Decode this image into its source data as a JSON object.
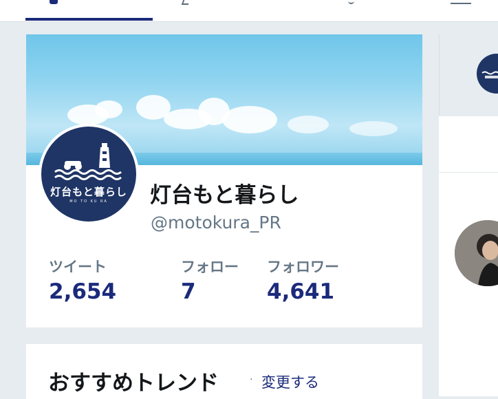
{
  "profile": {
    "display_name": "灯台もと暮らし",
    "handle": "@motokura_PR",
    "avatar_logo_text": "灯台もと暮らし",
    "avatar_logo_sub": "MO TO KU RA"
  },
  "stats": [
    {
      "label": "ツイート",
      "value": "2,654"
    },
    {
      "label": "フォロー",
      "value": "7"
    },
    {
      "label": "フォロワー",
      "value": "4,641"
    }
  ],
  "trends": {
    "title": "おすすめトレンド",
    "separator": "·",
    "change_label": "変更する"
  },
  "icons": {
    "nav": [
      "home-icon",
      "notifications-icon",
      "messages-icon",
      "menu-icon"
    ]
  },
  "colors": {
    "accent": "#1b2a7a",
    "background": "#e6ecf0",
    "avatar_bg": "#1f3565",
    "secondary_text": "#657786"
  }
}
